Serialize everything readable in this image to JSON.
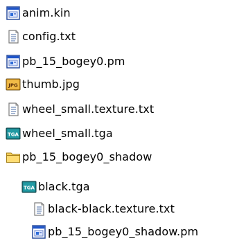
{
  "file_tree": {
    "items": [
      {
        "name": "anim.kin",
        "icon": "app-file-icon"
      },
      {
        "name": "config.txt",
        "icon": "text-file-icon"
      },
      {
        "name": "pb_15_bogey0.pm",
        "icon": "app-file-icon"
      },
      {
        "name": "thumb.jpg",
        "icon": "jpg-image-icon"
      },
      {
        "name": "wheel_small.texture.txt",
        "icon": "text-file-icon"
      },
      {
        "name": "wheel_small.tga",
        "icon": "tga-image-icon"
      },
      {
        "name": "pb_15_bogey0_shadow",
        "icon": "folder-icon"
      },
      {
        "name": "black.tga",
        "icon": "tga-image-icon"
      },
      {
        "name": "black-black.texture.txt",
        "icon": "text-file-icon"
      },
      {
        "name": "pb_15_bogey0_shadow.pm",
        "icon": "app-file-icon"
      }
    ]
  },
  "colors": {
    "text": "#000000",
    "background": "#ffffff",
    "app_icon_blue": "#1f55c9",
    "folder_yellow": "#f5cf5a",
    "image_icon_teal": "#1c7f86",
    "jpg_icon_orange": "#e3a22d"
  }
}
